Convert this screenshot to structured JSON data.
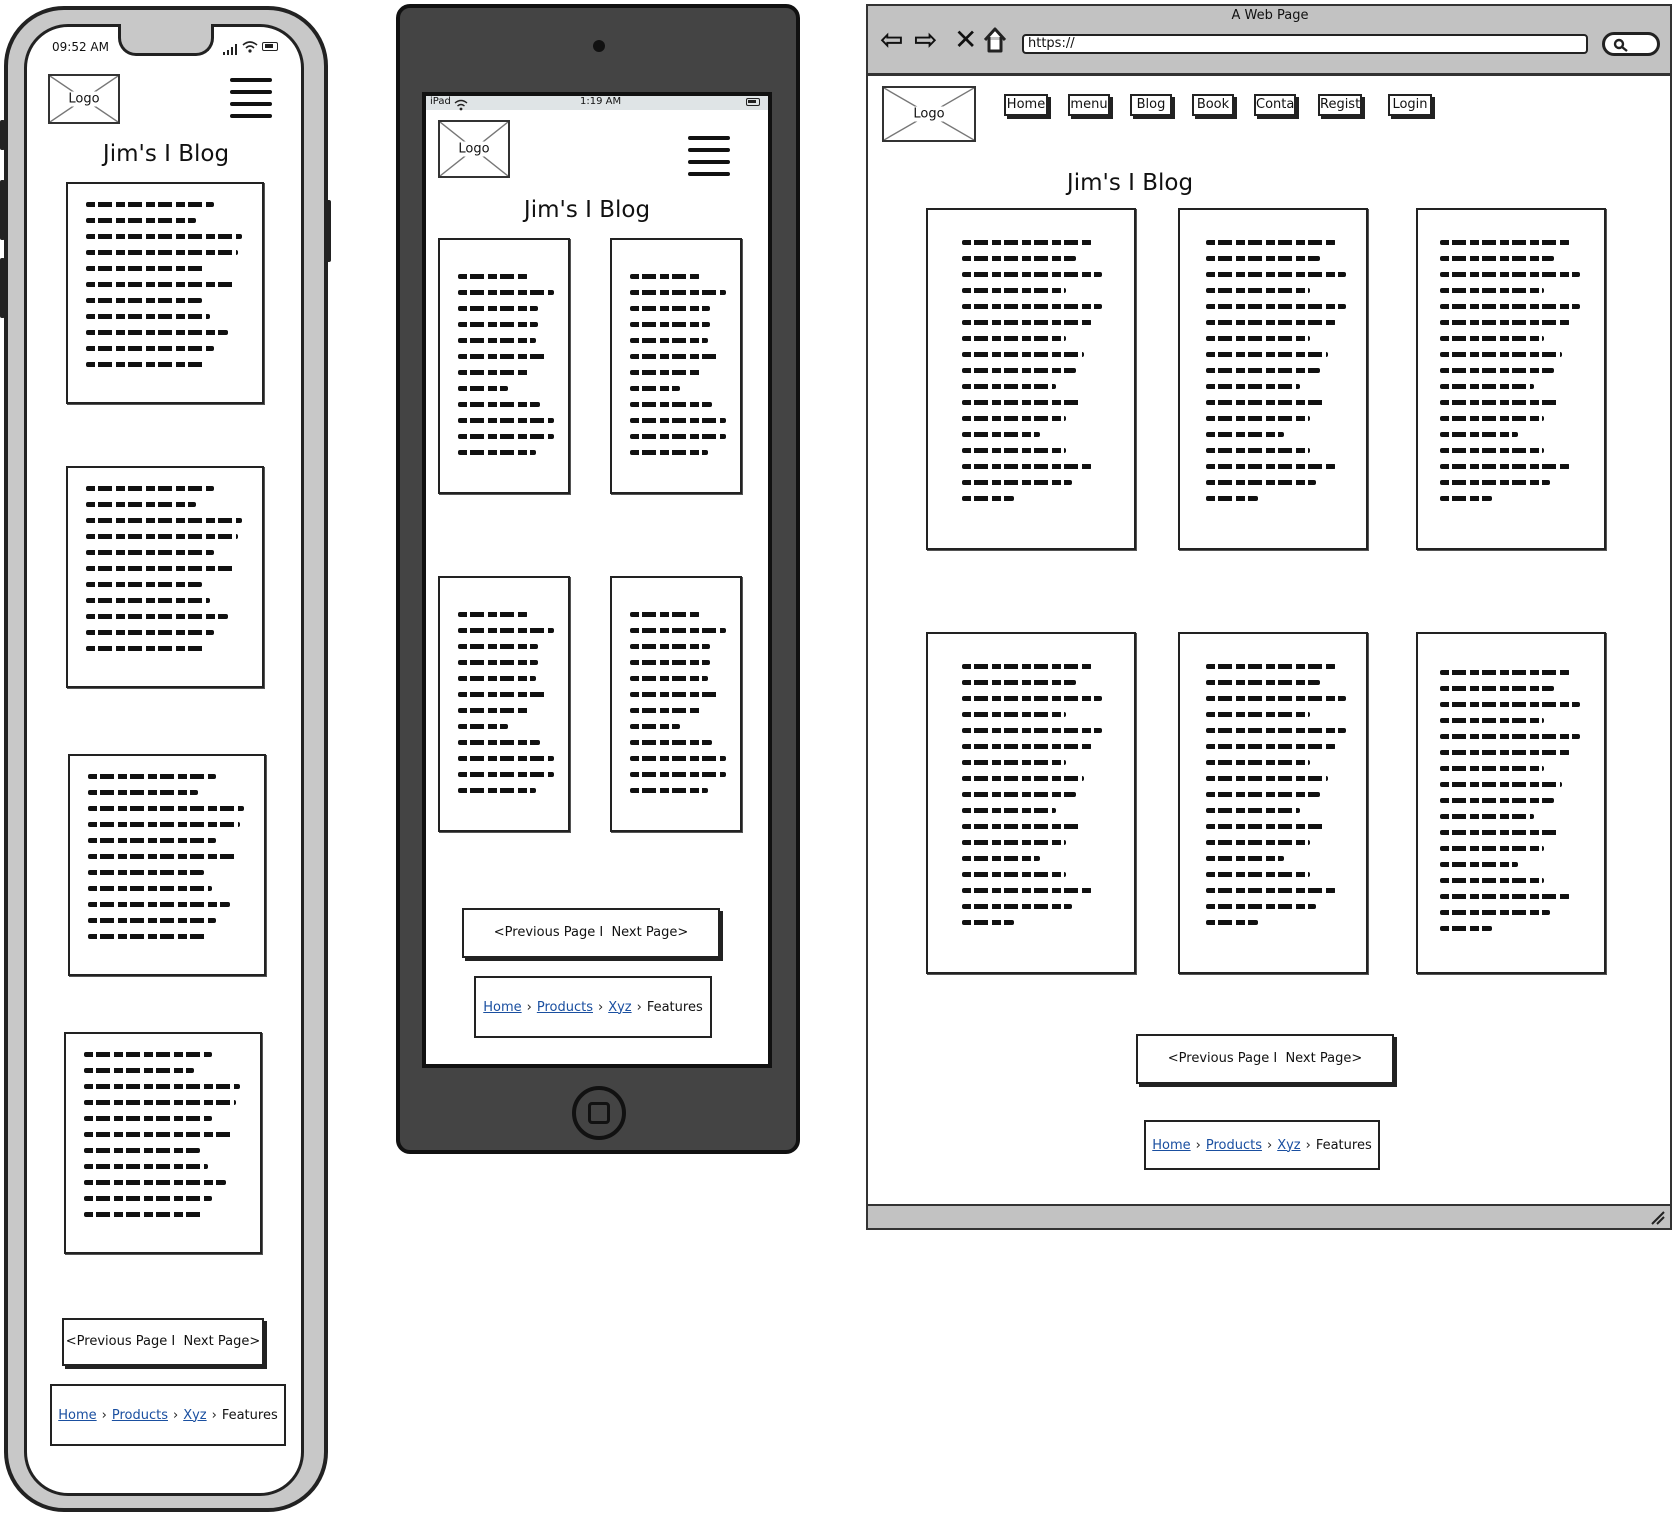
{
  "brand": {
    "logo_label": "Logo",
    "blog_title": "Jim's I Blog"
  },
  "phone": {
    "time": "09:52 AM"
  },
  "tablet": {
    "device_label": "iPad",
    "time": "1:19 AM"
  },
  "browser": {
    "window_title": "A Web Page",
    "url": "https://",
    "nav_items": [
      "Home",
      "menu",
      "Blog",
      "Book",
      "Conta",
      "Regist",
      "Login"
    ]
  },
  "pager": {
    "prev": "<Previous Page I",
    "next": "Next Page>"
  },
  "breadcrumb": {
    "links": [
      "Home",
      "Products",
      "Xyz"
    ],
    "current": "Features",
    "link_color": "#1a4fa0"
  },
  "colors": {
    "device_bezel": "#444444",
    "phone_shell": "#c8c8c8",
    "browser_chrome": "#c2c2c2"
  }
}
